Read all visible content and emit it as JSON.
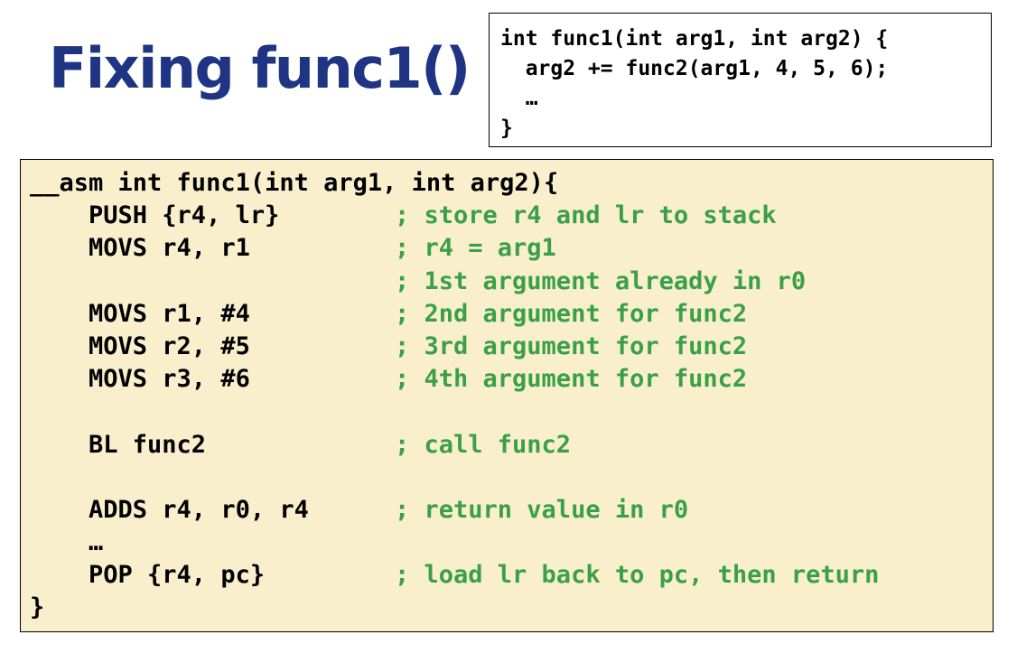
{
  "slide": {
    "title": "Fixing func1()"
  },
  "c_code": {
    "lines": [
      "int func1(int arg1, int arg2) {",
      "  arg2 += func2(arg1, 4, 5, 6);",
      "  …",
      "}"
    ]
  },
  "asm_code": {
    "header": "__asm int func1(int arg1, int arg2){",
    "lines": [
      {
        "code": "    PUSH {r4, lr}",
        "comment": "; store r4 and lr to stack"
      },
      {
        "code": "    MOVS r4, r1",
        "comment": "; r4 = arg1"
      },
      {
        "code": "",
        "comment": "; 1st argument already in r0"
      },
      {
        "code": "    MOVS r1, #4",
        "comment": "; 2nd argument for func2"
      },
      {
        "code": "    MOVS r2, #5",
        "comment": "; 3rd argument for func2"
      },
      {
        "code": "    MOVS r3, #6",
        "comment": "; 4th argument for func2"
      },
      {
        "code": "",
        "comment": ""
      },
      {
        "code": "    BL func2",
        "comment": "; call func2"
      },
      {
        "code": "",
        "comment": ""
      },
      {
        "code": "    ADDS r4, r0, r4",
        "comment": "; return value in r0"
      },
      {
        "code": "    …",
        "comment": ""
      },
      {
        "code": "    POP {r4, pc}",
        "comment": "; load lr back to pc, then return"
      }
    ],
    "footer": "}"
  },
  "colors": {
    "title": "#1f3583",
    "comment": "#3aa047",
    "asm_background": "#f9efcd"
  }
}
